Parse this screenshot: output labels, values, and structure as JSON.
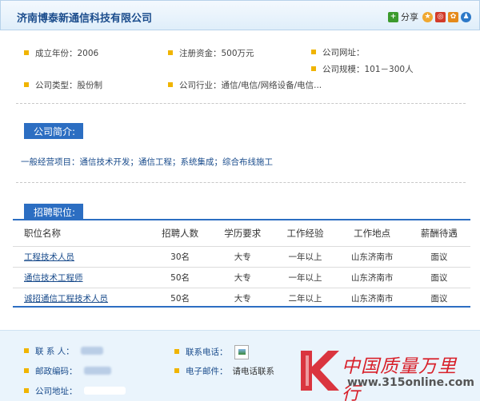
{
  "header": {
    "title": "济南博泰新通信科技有限公司",
    "share_label": "分享"
  },
  "info": {
    "founded": "成立年份：2006",
    "capital": "注册资金：500万元",
    "website": "公司网址：",
    "scale": "公司规模：101－300人",
    "type": "公司类型：股份制",
    "industry": "公司行业：通信/电信/网络设备/电信..."
  },
  "intro": {
    "tab": "公司简介:",
    "text": "一般经营项目：通信技术开发；通信工程；系统集成；综合布线施工"
  },
  "jobs": {
    "tab": "招聘职位:",
    "headers": [
      "职位名称",
      "招聘人数",
      "学历要求",
      "工作经验",
      "工作地点",
      "薪酬待遇"
    ],
    "rows": [
      [
        "工程技术人员",
        "30名",
        "大专",
        "一年以上",
        "山东济南市",
        "面议"
      ],
      [
        "通信技术工程师",
        "50名",
        "大专",
        "一年以上",
        "山东济南市",
        "面议"
      ],
      [
        "诚招通信工程技术人员",
        "50名",
        "大专",
        "二年以上",
        "山东济南市",
        "面议"
      ]
    ]
  },
  "contact": {
    "person_label": "联 系 人：",
    "phone_label": "联系电话：",
    "zip_label": "邮政编码：",
    "email_label": "电子邮件：",
    "email_value": "请电话联系",
    "address_label": "公司地址："
  },
  "watermark": {
    "text": "中国质量万里行",
    "url": "www.315online.com"
  },
  "colors": {
    "brand_blue": "#2c6ec2",
    "link_blue": "#1a4c8c",
    "bullet": "#f0b400",
    "watermark_red": "#d8202a"
  }
}
